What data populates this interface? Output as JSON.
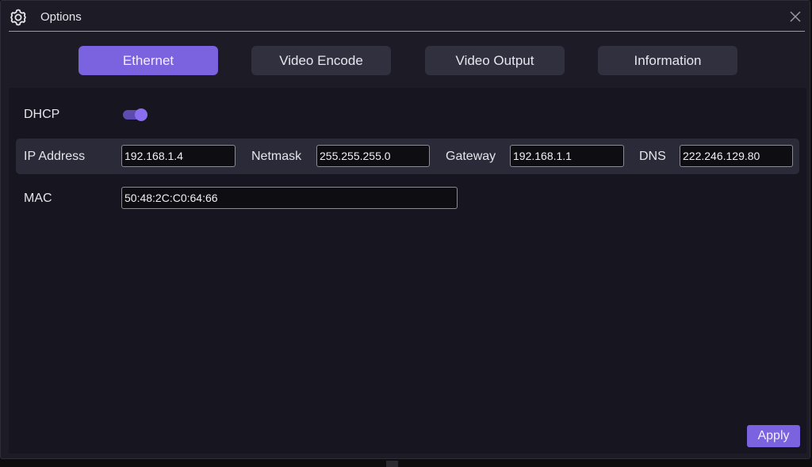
{
  "window": {
    "title": "Options",
    "title_icon": "gear-icon",
    "close_icon": "close-icon"
  },
  "tabs": [
    {
      "label": "Ethernet",
      "active": true
    },
    {
      "label": "Video Encode",
      "active": false
    },
    {
      "label": "Video Output",
      "active": false
    },
    {
      "label": "Information",
      "active": false
    }
  ],
  "ethernet": {
    "dhcp_label": "DHCP",
    "dhcp_enabled": true,
    "ip_label": "IP Address",
    "ip_value": "192.168.1.4",
    "netmask_label": "Netmask",
    "netmask_value": "255.255.255.0",
    "gateway_label": "Gateway",
    "gateway_value": "192.168.1.1",
    "dns_label": "DNS",
    "dns_value": "222.246.129.80",
    "mac_label": "MAC",
    "mac_value": "50:48:2C:C0:64:66"
  },
  "footer": {
    "apply_label": "Apply"
  },
  "colors": {
    "accent": "#7b62df",
    "window_bg": "#1c1b26",
    "panel_bg": "#171620",
    "row_bg": "#2a2a38",
    "tab_bg": "#30303f"
  }
}
